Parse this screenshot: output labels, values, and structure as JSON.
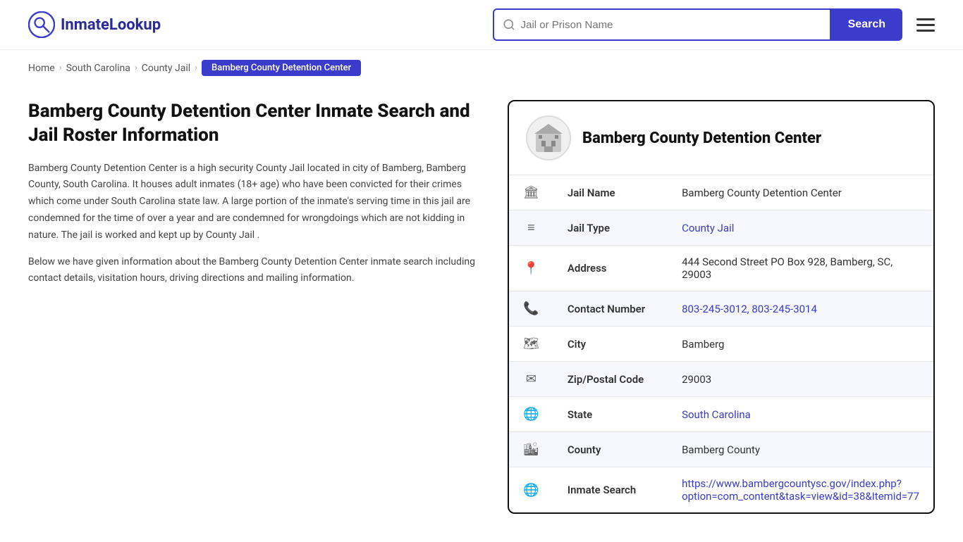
{
  "header": {
    "logo_text": "InmateLookup",
    "search_placeholder": "Jail or Prison Name",
    "search_button_label": "Search"
  },
  "breadcrumb": {
    "items": [
      {
        "label": "Home",
        "href": "#"
      },
      {
        "label": "South Carolina",
        "href": "#"
      },
      {
        "label": "County Jail",
        "href": "#"
      },
      {
        "label": "Bamberg County Detention Center",
        "active": true
      }
    ]
  },
  "left": {
    "title": "Bamberg County Detention Center Inmate Search and Jail Roster Information",
    "desc1": "Bamberg County Detention Center is a high security County Jail located in city of Bamberg, Bamberg County, South Carolina. It houses adult inmates (18+ age) who have been convicted for their crimes which come under South Carolina state law. A large portion of the inmate's serving time in this jail are condemned for the time of over a year and are condemned for wrongdoings which are not kidding in nature. The jail is worked and kept up by County Jail .",
    "desc2": "Below we have given information about the Bamberg County Detention Center inmate search including contact details, visitation hours, driving directions and mailing information."
  },
  "facility": {
    "name": "Bamberg County Detention Center",
    "fields": [
      {
        "icon": "jail-icon",
        "label": "Jail Name",
        "value": "Bamberg County Detention Center",
        "link": false
      },
      {
        "icon": "list-icon",
        "label": "Jail Type",
        "value": "County Jail",
        "link": true
      },
      {
        "icon": "location-icon",
        "label": "Address",
        "value": "444 Second Street PO Box 928, Bamberg, SC, 29003",
        "link": false
      },
      {
        "icon": "phone-icon",
        "label": "Contact Number",
        "value": "803-245-3012, 803-245-3014",
        "link": true
      },
      {
        "icon": "city-icon",
        "label": "City",
        "value": "Bamberg",
        "link": false
      },
      {
        "icon": "zip-icon",
        "label": "Zip/Postal Code",
        "value": "29003",
        "link": false
      },
      {
        "icon": "globe-icon",
        "label": "State",
        "value": "South Carolina",
        "link": true
      },
      {
        "icon": "county-icon",
        "label": "County",
        "value": "Bamberg County",
        "link": false
      },
      {
        "icon": "search-icon",
        "label": "Inmate Search",
        "value": "https://www.bambergcountysc.gov/index.php?option=com_content&task=view&id=38&Itemid=77",
        "link": true
      }
    ]
  }
}
